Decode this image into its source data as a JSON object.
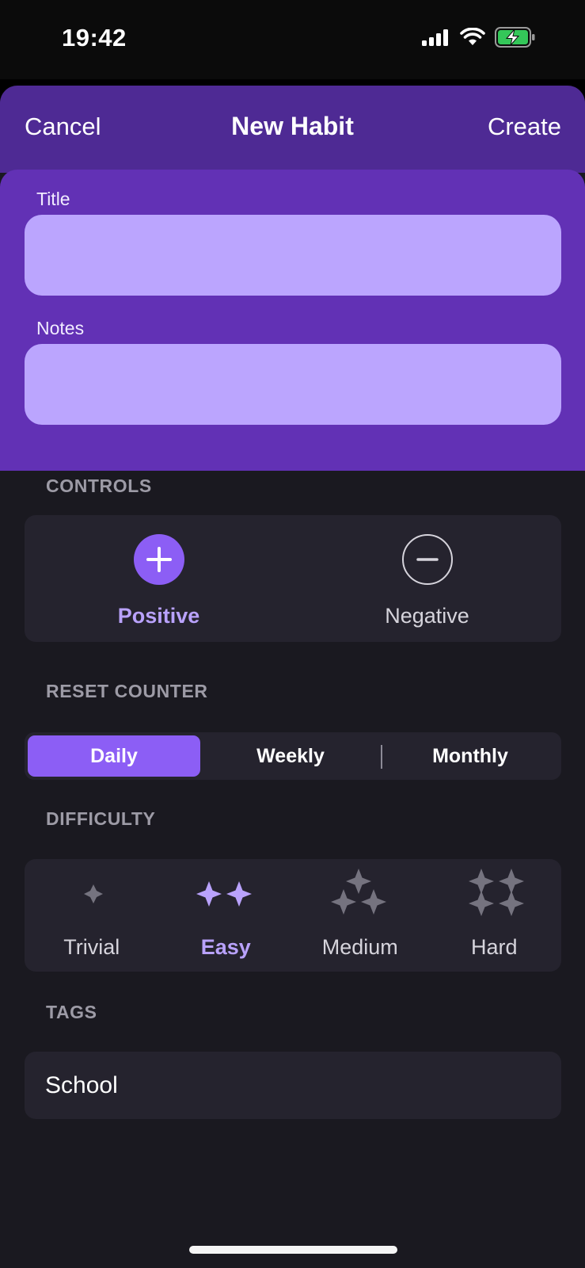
{
  "status_bar": {
    "time": "19:42",
    "battery_color": "#34c759"
  },
  "nav": {
    "cancel": "Cancel",
    "title": "New Habit",
    "create": "Create"
  },
  "form": {
    "title_label": "Title",
    "title_value": "",
    "notes_label": "Notes",
    "notes_value": ""
  },
  "controls": {
    "section": "CONTROLS",
    "positive": {
      "label": "Positive",
      "icon": "plus-circle-icon",
      "selected": true
    },
    "negative": {
      "label": "Negative",
      "icon": "minus-circle-icon",
      "selected": false
    }
  },
  "reset_counter": {
    "section": "RESET COUNTER",
    "options": [
      "Daily",
      "Weekly",
      "Monthly"
    ],
    "selected": "Daily"
  },
  "difficulty": {
    "section": "DIFFICULTY",
    "options": [
      "Trivial",
      "Easy",
      "Medium",
      "Hard"
    ],
    "selected": "Easy"
  },
  "tags": {
    "section": "TAGS",
    "value": "School"
  },
  "colors": {
    "accent": "#8c5ef5",
    "accent_light": "#b9a2fc",
    "nav_bg": "#4e2a94",
    "form_bg": "#6231b5",
    "field_bg": "#bba5fe",
    "sheet_bg": "#1a1920",
    "card_bg": "#25232e"
  }
}
